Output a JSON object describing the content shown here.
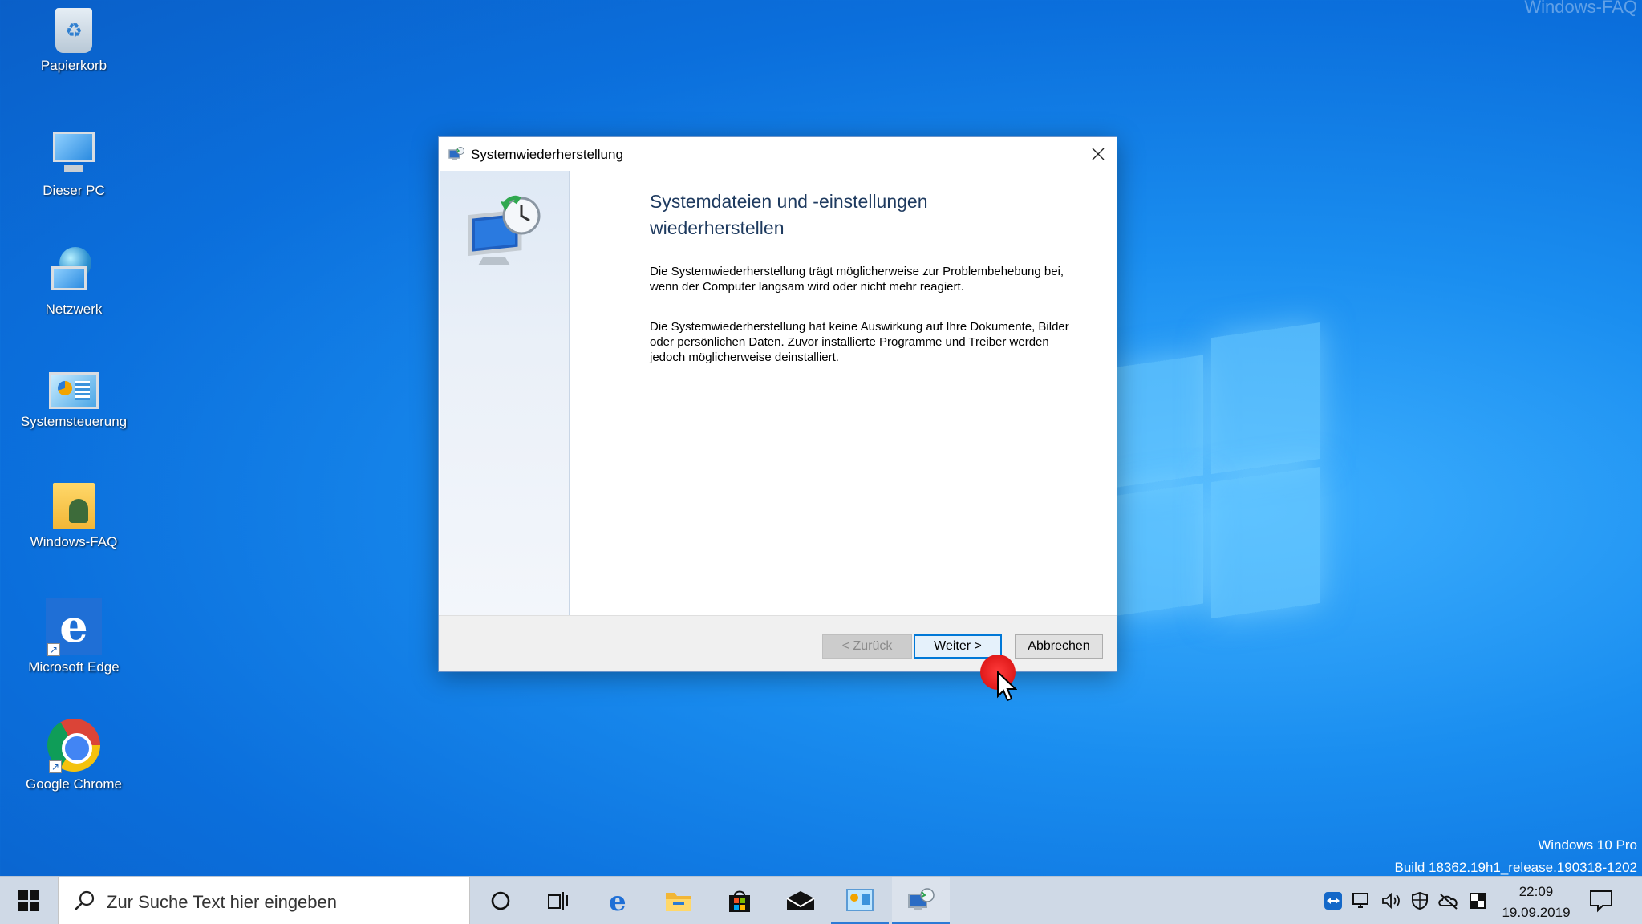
{
  "desktop": {
    "watermark": "Windows-FAQ",
    "icons": [
      {
        "label": "Papierkorb",
        "icon": "recycle-bin-icon"
      },
      {
        "label": "Dieser PC",
        "icon": "computer-icon"
      },
      {
        "label": "Netzwerk",
        "icon": "network-icon"
      },
      {
        "label": "Systemsteuerung",
        "icon": "control-panel-icon"
      },
      {
        "label": "Windows-FAQ",
        "icon": "user-folder-icon"
      },
      {
        "label": "Microsoft Edge",
        "icon": "edge-icon"
      },
      {
        "label": "Google Chrome",
        "icon": "chrome-icon"
      }
    ],
    "build_info": {
      "edition": "Windows 10 Pro",
      "build": "Build 18362.19h1_release.190318-1202"
    }
  },
  "dialog": {
    "title": "Systemwiederherstellung",
    "heading_line1": "Systemdateien und -einstellungen",
    "heading_line2": "wiederherstellen",
    "paragraph1": "Die Systemwiederherstellung trägt möglicherweise zur Problembehebung bei, wenn der Computer langsam wird oder nicht mehr reagiert.",
    "paragraph2": "Die Systemwiederherstellung hat keine Auswirkung auf Ihre Dokumente, Bilder oder persönlichen Daten. Zuvor installierte Programme und Treiber werden jedoch möglicherweise deinstalliert.",
    "buttons": {
      "back": "< Zurück",
      "next": "Weiter >",
      "cancel": "Abbrechen"
    }
  },
  "taskbar": {
    "search_placeholder": "Zur Suche Text hier eingeben",
    "clock_time": "22:09",
    "clock_date": "19.09.2019"
  },
  "colors": {
    "accent": "#0078d7",
    "desktop_blue": "#0b6fdc",
    "taskbar": "#cfd9e6"
  }
}
